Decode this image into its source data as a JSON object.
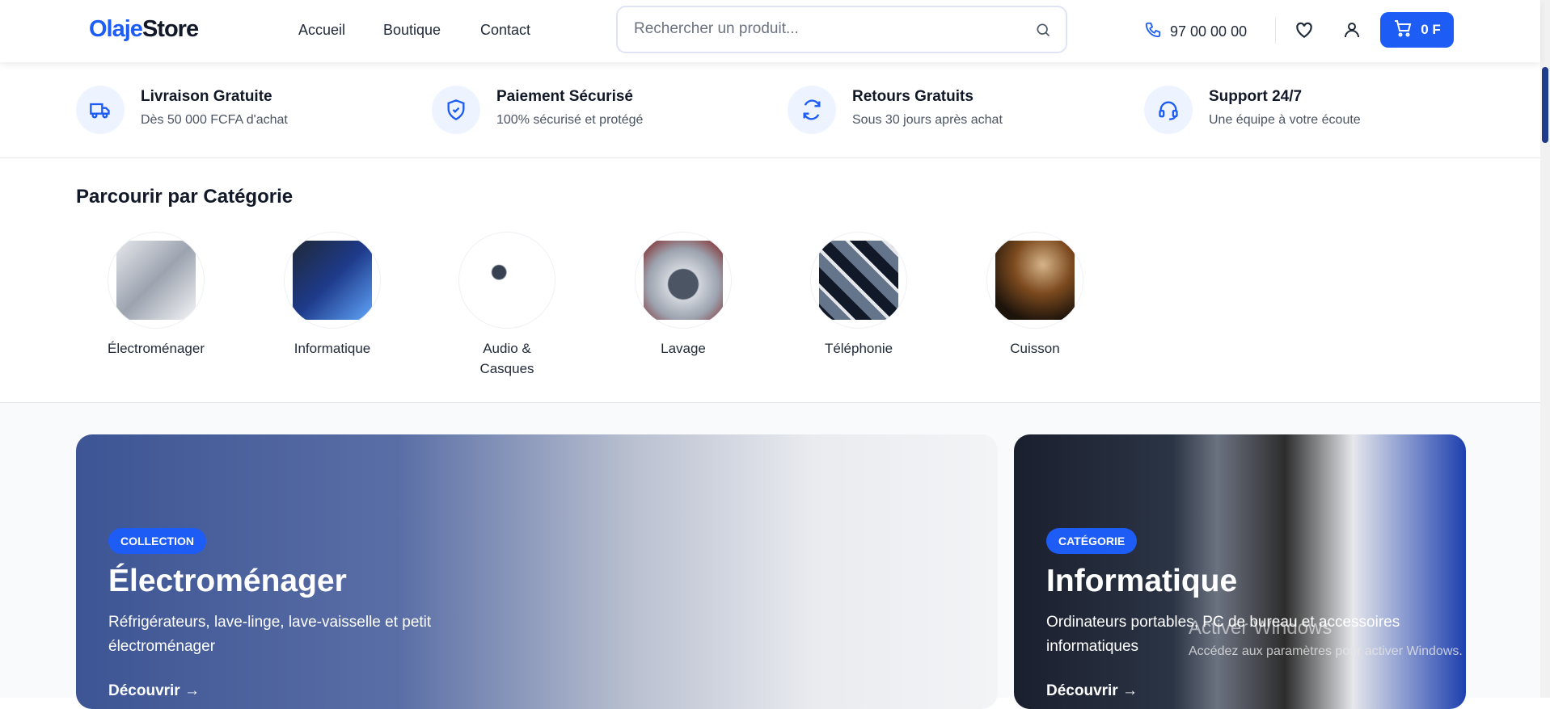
{
  "header": {
    "logo_part1": "Olaje",
    "logo_part2": "Store",
    "nav": [
      "Accueil",
      "Boutique",
      "Contact"
    ],
    "search_placeholder": "Rechercher un produit...",
    "phone": "97 00 00 00",
    "cart_total": "0 F"
  },
  "features": [
    {
      "title": "Livraison Gratuite",
      "subtitle": "Dès 50 000 FCFA d'achat",
      "icon": "truck-icon"
    },
    {
      "title": "Paiement Sécurisé",
      "subtitle": "100% sécurisé et protégé",
      "icon": "shield-check-icon"
    },
    {
      "title": "Retours Gratuits",
      "subtitle": "Sous 30 jours après achat",
      "icon": "refresh-icon"
    },
    {
      "title": "Support 24/7",
      "subtitle": "Une équipe à votre écoute",
      "icon": "headset-icon"
    }
  ],
  "categories": {
    "title": "Parcourir par Catégorie",
    "items": [
      "Électroménager",
      "Informatique",
      "Audio & Casques",
      "Lavage",
      "Téléphonie",
      "Cuisson"
    ]
  },
  "banners": [
    {
      "badge": "COLLECTION",
      "title": "Électroménager",
      "description": "Réfrigérateurs, lave-linge, lave-vaisselle et petit électroménager",
      "cta": "Découvrir →"
    },
    {
      "badge": "CATÉGORIE",
      "title": "Informatique",
      "description": "Ordinateurs portables, PC de bureau et accessoires informatiques",
      "cta": "Découvrir →"
    }
  ],
  "watermark": {
    "title": "Activer Windows",
    "subtitle": "Accédez aux paramètres pour activer Windows."
  },
  "colors": {
    "accent": "#1d5cf5",
    "icon_bg": "#eef4ff"
  }
}
